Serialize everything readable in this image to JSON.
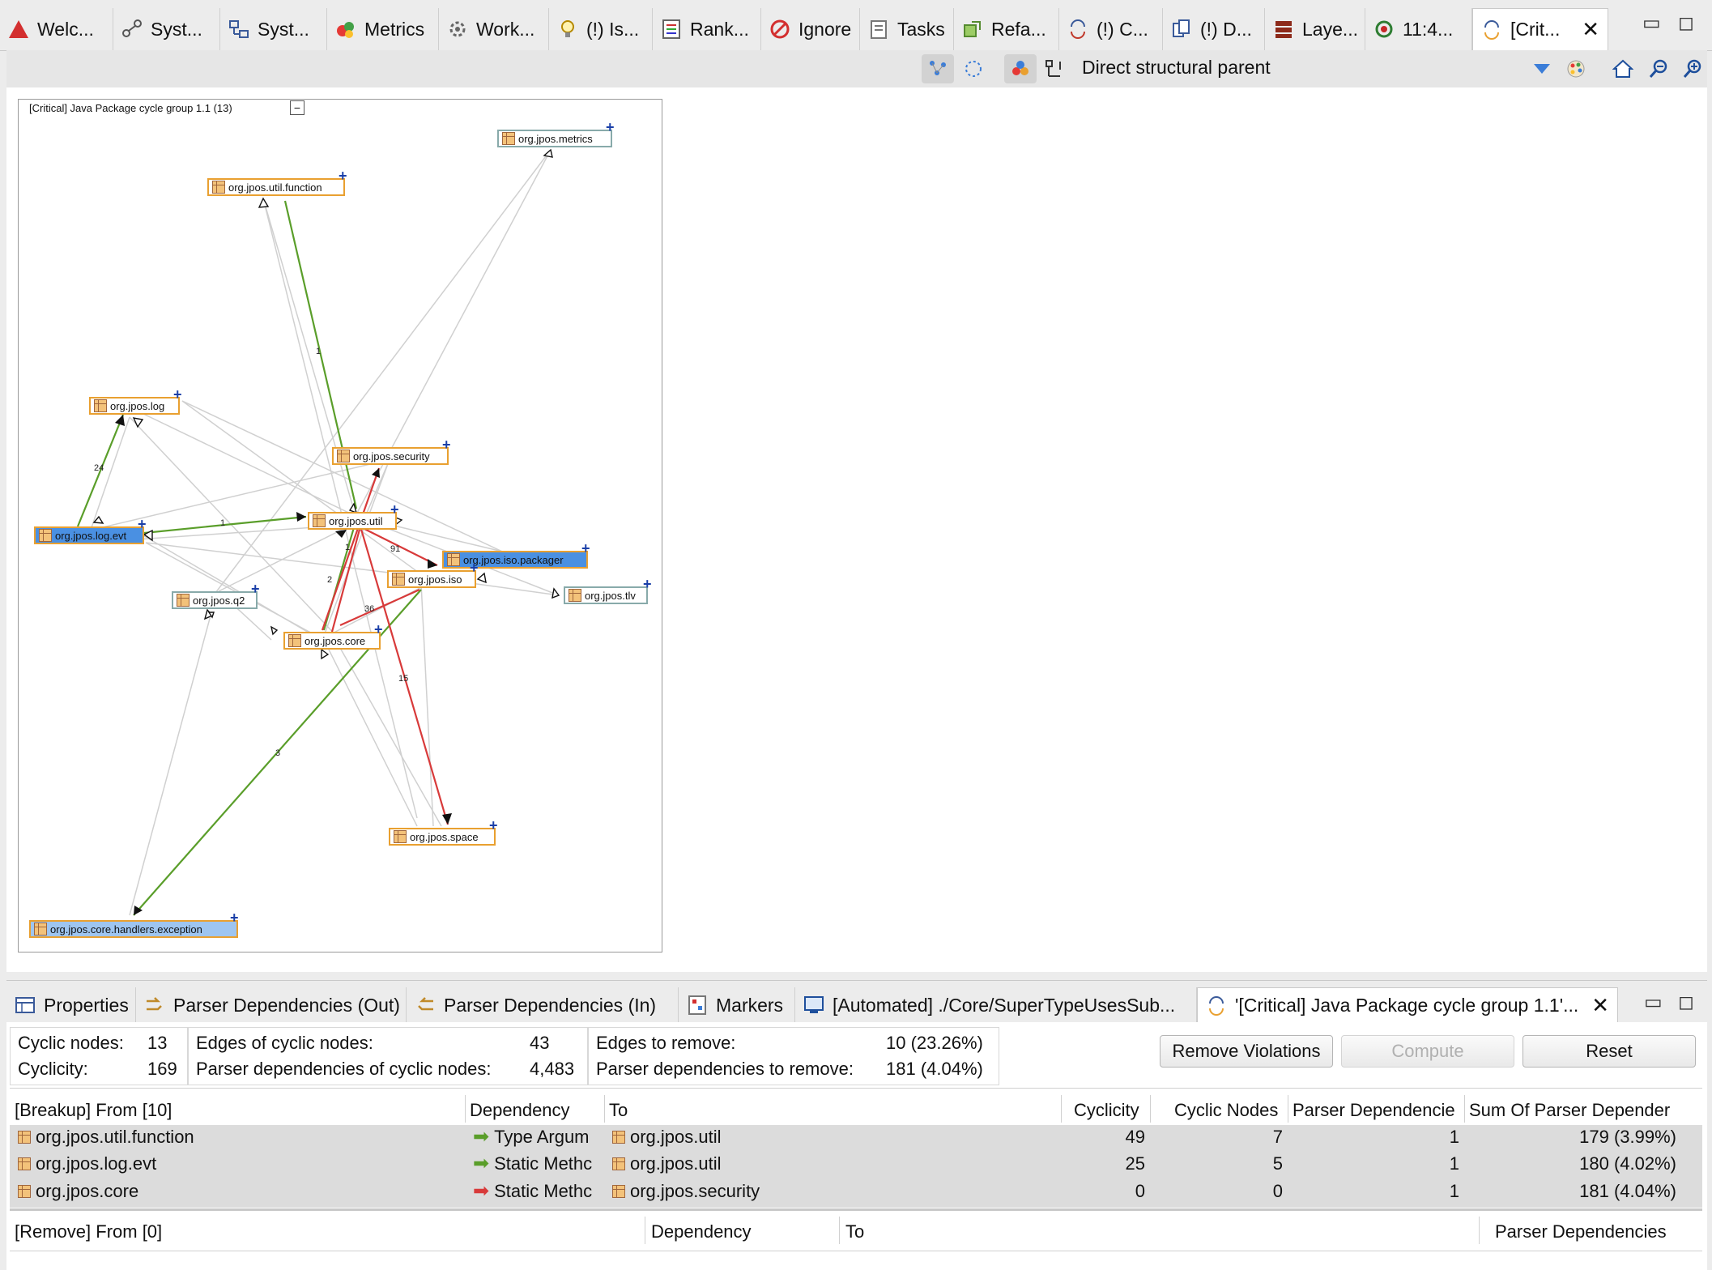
{
  "tabs": [
    {
      "label": "Welc...",
      "icon": "warning-triangle-icon"
    },
    {
      "label": "Syst...",
      "icon": "system-graph-icon"
    },
    {
      "label": "Syst...",
      "icon": "system-structure-icon"
    },
    {
      "label": "Metrics",
      "icon": "metrics-icon"
    },
    {
      "label": "Work...",
      "icon": "workspace-icon"
    },
    {
      "label": "(!) Is...",
      "icon": "lightbulb-icon"
    },
    {
      "label": "Rank...",
      "icon": "ranking-icon"
    },
    {
      "label": "Ignore",
      "icon": "ignore-icon"
    },
    {
      "label": "Tasks",
      "icon": "tasks-icon"
    },
    {
      "label": "Refa...",
      "icon": "refactoring-icon"
    },
    {
      "label": "(!) C...",
      "icon": "cycle-icon"
    },
    {
      "label": "(!) D...",
      "icon": "duplicate-icon"
    },
    {
      "label": "Laye...",
      "icon": "layers-icon"
    },
    {
      "label": "11:4...",
      "icon": "refresh-icon"
    },
    {
      "label": "[Crit...",
      "icon": "cycle-group-icon"
    }
  ],
  "toolbar": {
    "mode_label": "Direct structural parent"
  },
  "graph": {
    "title": "[Critical] Java Package cycle group 1.1 (13)",
    "nodes": [
      {
        "id": "metrics",
        "label": "org.jpos.metrics",
        "style": "plain"
      },
      {
        "id": "function",
        "label": "org.jpos.util.function",
        "style": "orange"
      },
      {
        "id": "log",
        "label": "org.jpos.log",
        "style": "orange"
      },
      {
        "id": "security",
        "label": "org.jpos.security",
        "style": "orange"
      },
      {
        "id": "logevt",
        "label": "org.jpos.log.evt",
        "style": "sel"
      },
      {
        "id": "util",
        "label": "org.jpos.util",
        "style": "orange"
      },
      {
        "id": "packager",
        "label": "org.jpos.iso.packager",
        "style": "sel"
      },
      {
        "id": "iso",
        "label": "org.jpos.iso",
        "style": "orange"
      },
      {
        "id": "tlv",
        "label": "org.jpos.tlv",
        "style": "plain"
      },
      {
        "id": "q2",
        "label": "org.jpos.q2",
        "style": "plain"
      },
      {
        "id": "core",
        "label": "org.jpos.core",
        "style": "orange"
      },
      {
        "id": "space",
        "label": "org.jpos.space",
        "style": "orange"
      },
      {
        "id": "exception",
        "label": "org.jpos.core.handlers.exception",
        "style": "selb"
      }
    ],
    "edge_labels": [
      "1",
      "24",
      "1",
      "91",
      "2",
      "1",
      "36",
      "15",
      "3"
    ]
  },
  "bottom_tabs": [
    {
      "label": "Properties",
      "icon": "properties-icon"
    },
    {
      "label": "Parser Dependencies (Out)",
      "icon": "dependencies-out-icon"
    },
    {
      "label": "Parser Dependencies (In)",
      "icon": "dependencies-in-icon"
    },
    {
      "label": "Markers",
      "icon": "markers-icon"
    },
    {
      "label": "[Automated] ./Core/SuperTypeUsesSub...",
      "icon": "console-icon"
    },
    {
      "label": "'[Critical] Java Package cycle group 1.1'...",
      "icon": "cycle-group-icon"
    }
  ],
  "stats": {
    "cyclic_nodes_label": "Cyclic nodes:",
    "cyclic_nodes": "13",
    "cyclicity_label": "Cyclicity:",
    "cyclicity": "169",
    "edges_label": "Edges of cyclic nodes:",
    "edges": "43",
    "parser_deps_label": "Parser dependencies of cyclic nodes:",
    "parser_deps": "4,483",
    "edges_remove_label": "Edges to remove:",
    "edges_remove": "10 (23.26%)",
    "deps_remove_label": "Parser dependencies to remove:",
    "deps_remove": "181 (4.04%)"
  },
  "buttons": {
    "remove": "Remove Violations",
    "compute": "Compute",
    "reset": "Reset"
  },
  "breakup_table": {
    "headers": [
      "[Breakup] From [10]",
      "Dependency",
      "To",
      "Cyclicity",
      "Cyclic Nodes",
      "Parser Dependencie",
      "Sum Of Parser Depender"
    ],
    "rows": [
      {
        "from": "org.jpos.util.function",
        "dep": "Type Argum",
        "dep_color": "green",
        "to": "org.jpos.util",
        "cyclicity": "49",
        "nodes": "7",
        "parser": "1",
        "sum": "179 (3.99%)"
      },
      {
        "from": "org.jpos.log.evt",
        "dep": "Static Methc",
        "dep_color": "green",
        "to": "org.jpos.util",
        "cyclicity": "25",
        "nodes": "5",
        "parser": "1",
        "sum": "180 (4.02%)"
      },
      {
        "from": "org.jpos.core",
        "dep": "Static Methc",
        "dep_color": "red",
        "to": "org.jpos.security",
        "cyclicity": "0",
        "nodes": "0",
        "parser": "1",
        "sum": "181 (4.04%)"
      }
    ]
  },
  "remove_table": {
    "headers": [
      "[Remove] From [0]",
      "Dependency",
      "To",
      "Parser Dependencies"
    ]
  }
}
